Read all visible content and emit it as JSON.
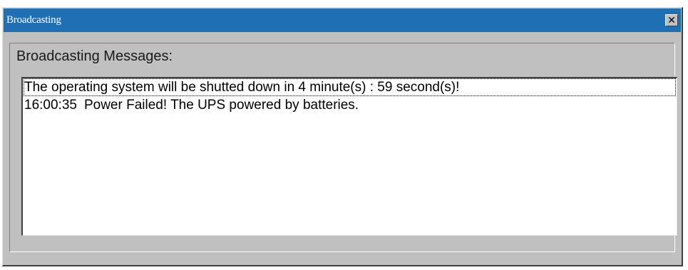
{
  "window": {
    "title": "Broadcasting",
    "close_glyph": "✕",
    "close_icon": "close-icon"
  },
  "group": {
    "label": "Broadcasting Messages:"
  },
  "messages": [
    {
      "time": "",
      "text": "The operating system will be shutted down in 4 minute(s) : 59 second(s)!"
    },
    {
      "time": "16:00:35",
      "text": "Power Failed! The UPS powered by batteries."
    }
  ]
}
